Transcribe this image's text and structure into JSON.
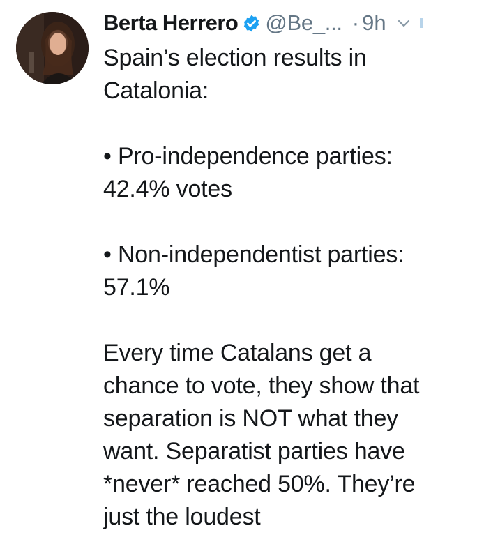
{
  "tweet": {
    "author_name": "Berta Herrero",
    "handle": "@Be_...",
    "separator": "·",
    "time": "9h",
    "verified_color": "#1da1f2",
    "lines": {
      "intro_1": "Spain’s election results in",
      "intro_2": "Catalonia:",
      "bullet_1_label": "• Pro-independence parties:",
      "bullet_1_value": "42.4% votes",
      "bullet_2_label": "• Non-independentist parties:",
      "bullet_2_value": "57.1%",
      "closing_1": "Every time Catalans get a",
      "closing_2": "chance to vote, they show that",
      "closing_3": "separation is NOT what they",
      "closing_4": "want. Separatist parties have",
      "closing_5": "*never* reached 50%. They’re",
      "closing_6": "just the loudest"
    }
  },
  "icons": {
    "verified": "verified-badge-icon",
    "chevron": "chevron-down-icon"
  }
}
